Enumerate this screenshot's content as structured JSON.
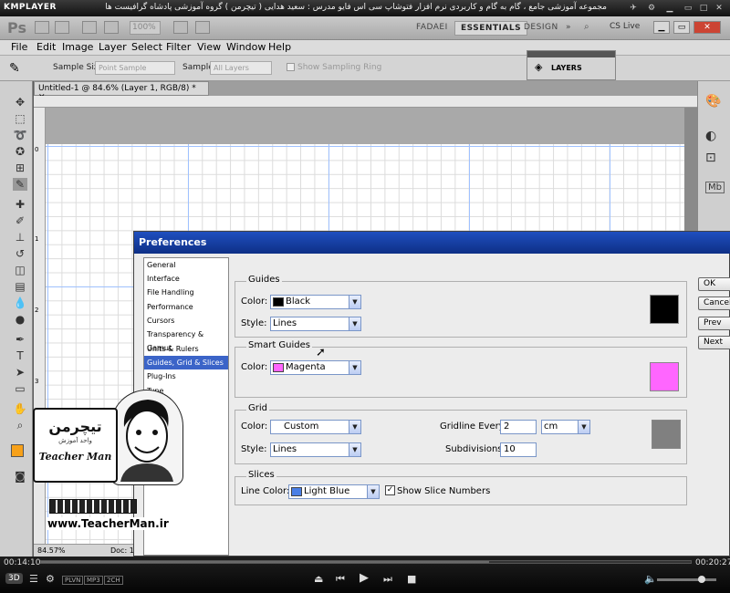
{
  "player": {
    "logo": "KMPLAYER",
    "video_title": "مجموعه آموزشی جامع ، گام به گام و کاربردی نرم افزار فتوشاپ سی اس فایو  مدرس : سعید هدایی ( تیچرمن ) گروه آموزشی پادشاه گرافیست ها",
    "time_elapsed": "00:14:10",
    "time_total": "00:20:27",
    "seek_progress": 0.69,
    "volume": 0.75,
    "btn_3d": "3D",
    "badges": [
      "PLVN",
      "MP3",
      "2CH"
    ]
  },
  "ps": {
    "logo": "Ps",
    "zoom": "100%",
    "workspaces": [
      "FADAEI",
      "ESSENTIALS",
      "DESIGN"
    ],
    "active_workspace": "ESSENTIALS",
    "cs_live": "CS Live"
  },
  "menu": [
    "File",
    "Edit",
    "Image",
    "Layer",
    "Select",
    "Filter",
    "View",
    "Window",
    "Help"
  ],
  "options": {
    "sample_size_label": "Sample Size:",
    "sample_size_value": "Point Sample",
    "sample_label": "Sample:",
    "sample_value": "All Layers",
    "show_ring": "Show Sampling Ring"
  },
  "layers_panel": {
    "title": "LAYERS"
  },
  "document": {
    "tab": "Untitled-1 @ 84.6% (Layer 1, RGB/8) *",
    "zoom_status": "84.57%",
    "doc_status": "Doc: 1"
  },
  "ruler_v": [
    "0",
    "1",
    "2",
    "3"
  ],
  "prefs": {
    "title": "Preferences",
    "categories": [
      "General",
      "Interface",
      "File Handling",
      "Performance",
      "Cursors",
      "Transparency & Gamut",
      "Units & Rulers",
      "Guides, Grid & Slices",
      "Plug-Ins",
      "Type"
    ],
    "selected_category": "Guides, Grid & Slices",
    "guides": {
      "title": "Guides",
      "color_label": "Color:",
      "color": "Black",
      "color_hex": "#000000",
      "style_label": "Style:",
      "style": "Lines"
    },
    "smart_guides": {
      "title": "Smart Guides",
      "color_label": "Color:",
      "color": "Magenta",
      "color_hex": "#ff66ff"
    },
    "grid": {
      "title": "Grid",
      "color_label": "Color:",
      "color": "Custom",
      "color_hex": "#808080",
      "style_label": "Style:",
      "style": "Lines",
      "gridline_label": "Gridline Every:",
      "gridline_value": "2",
      "gridline_unit": "cm",
      "subdiv_label": "Subdivisions:",
      "subdiv_value": "10"
    },
    "slices": {
      "title": "Slices",
      "line_color_label": "Line Color:",
      "line_color": "Light Blue",
      "line_color_hex": "#4a7fe6",
      "show_numbers": "Show Slice Numbers",
      "show_numbers_checked": true
    },
    "buttons": [
      "OK",
      "Cancel",
      "Prev",
      "Next"
    ]
  },
  "watermark": {
    "logo": "تیچرمن",
    "subtitle": "واحد آموزش",
    "name": "Teacher Man",
    "url": "www.TeacherMan.ir"
  }
}
